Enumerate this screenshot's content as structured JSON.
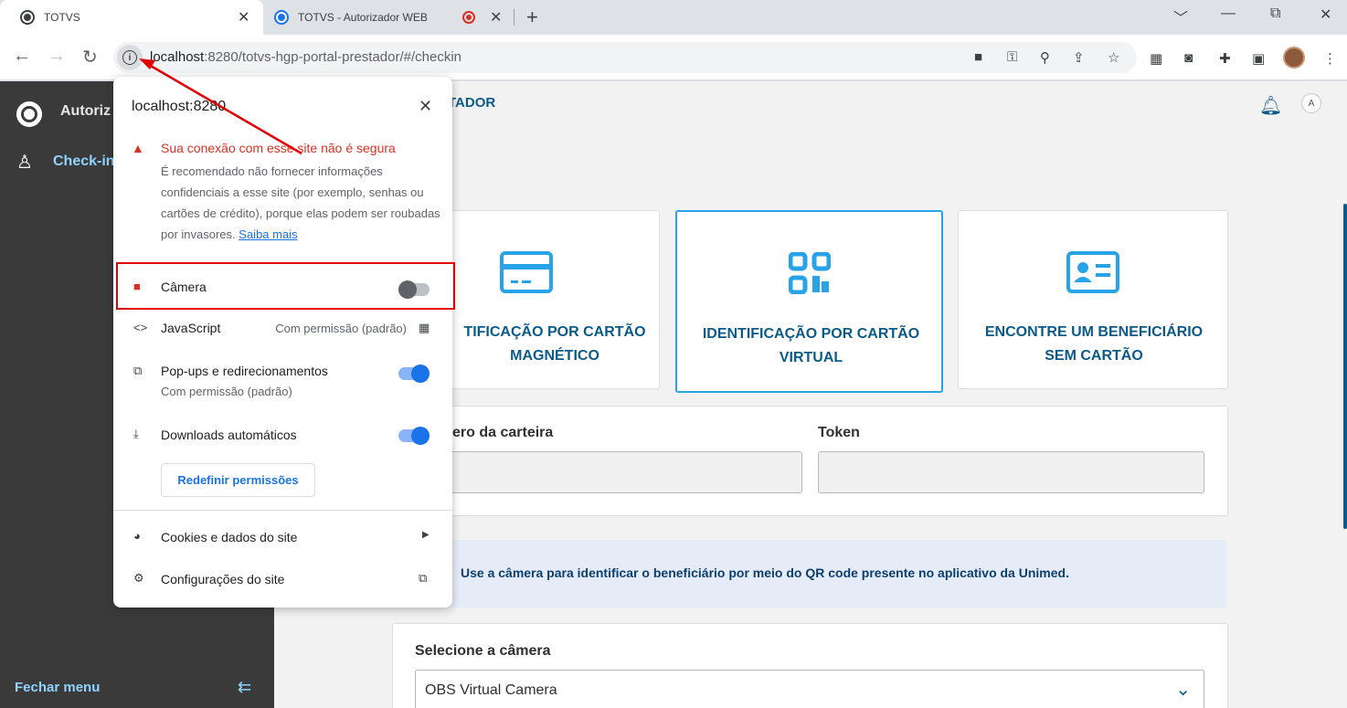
{
  "browser": {
    "tabs": [
      {
        "title": "TOTVS"
      },
      {
        "title": "TOTVS - Autorizador WEB"
      }
    ],
    "close_glyph": "✕",
    "new_tab_glyph": "+",
    "url": {
      "host": "localhost",
      "rest": ":8280/totvs-hgp-portal-prestador/#/checkin"
    },
    "window_controls": {
      "minimize": "﹀",
      "restore": "—",
      "maximize": "⧉",
      "close": "✕"
    }
  },
  "app": {
    "sidebar": {
      "title": "Autoriz",
      "items": [
        {
          "label": "Check-in"
        }
      ],
      "footer": "Fechar menu"
    },
    "header": {
      "title": "TADOR",
      "user_initial": "A"
    },
    "cards": [
      {
        "label_line1": "TIFICAÇÃO POR CARTÃO",
        "label_line2": "MAGNÉTICO"
      },
      {
        "label_line1": "IDENTIFICAÇÃO POR CARTÃO",
        "label_line2": "VIRTUAL"
      },
      {
        "label_line1": "ENCONTRE UM BENEFICIÁRIO",
        "label_line2": "SEM CARTÃO"
      }
    ],
    "form": {
      "card_number_label": "ero da carteira",
      "token_label": "Token"
    },
    "info_text": "Use a câmera para identificar o beneficiário por meio do QR code presente no aplicativo da Unimed.",
    "camera": {
      "label": "Selecione a câmera",
      "selected": "OBS Virtual Camera"
    }
  },
  "popup": {
    "host": "localhost:8280",
    "warning_title": "Sua conexão com esse site não é segura",
    "warning_text": "É recomendado não fornecer informações confidenciais a esse site (por exemplo, senhas ou cartões de crédito), porque elas podem ser roubadas por invasores.",
    "learn_more": "Saiba mais",
    "permissions": [
      {
        "label": "Câmera",
        "enabled": false
      },
      {
        "label": "JavaScript",
        "status": "Com permissão (padrão)"
      },
      {
        "label": "Pop-ups e redirecionamentos",
        "status": "Com permissão (padrão)",
        "enabled": true
      },
      {
        "label": "Downloads automáticos",
        "enabled": true
      }
    ],
    "reset_button": "Redefinir permissões",
    "links": [
      {
        "label": "Cookies e dados do site"
      },
      {
        "label": "Configurações do site"
      }
    ]
  },
  "colors": {
    "accent": "#0c5a8a",
    "selected_card_border": "#29a3e8",
    "warning": "#d93025",
    "annotation": "#e00000"
  }
}
